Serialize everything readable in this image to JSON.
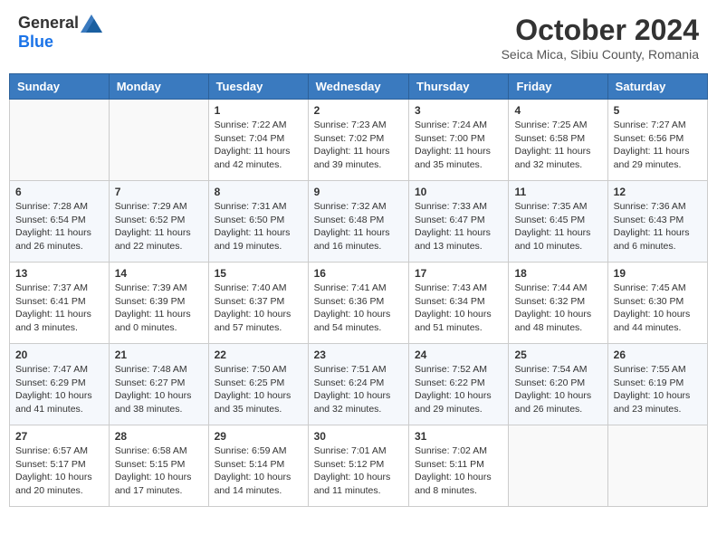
{
  "header": {
    "logo_general": "General",
    "logo_blue": "Blue",
    "month_title": "October 2024",
    "location": "Seica Mica, Sibiu County, Romania"
  },
  "days_of_week": [
    "Sunday",
    "Monday",
    "Tuesday",
    "Wednesday",
    "Thursday",
    "Friday",
    "Saturday"
  ],
  "weeks": [
    [
      {
        "day": "",
        "content": ""
      },
      {
        "day": "",
        "content": ""
      },
      {
        "day": "1",
        "content": "Sunrise: 7:22 AM\nSunset: 7:04 PM\nDaylight: 11 hours and 42 minutes."
      },
      {
        "day": "2",
        "content": "Sunrise: 7:23 AM\nSunset: 7:02 PM\nDaylight: 11 hours and 39 minutes."
      },
      {
        "day": "3",
        "content": "Sunrise: 7:24 AM\nSunset: 7:00 PM\nDaylight: 11 hours and 35 minutes."
      },
      {
        "day": "4",
        "content": "Sunrise: 7:25 AM\nSunset: 6:58 PM\nDaylight: 11 hours and 32 minutes."
      },
      {
        "day": "5",
        "content": "Sunrise: 7:27 AM\nSunset: 6:56 PM\nDaylight: 11 hours and 29 minutes."
      }
    ],
    [
      {
        "day": "6",
        "content": "Sunrise: 7:28 AM\nSunset: 6:54 PM\nDaylight: 11 hours and 26 minutes."
      },
      {
        "day": "7",
        "content": "Sunrise: 7:29 AM\nSunset: 6:52 PM\nDaylight: 11 hours and 22 minutes."
      },
      {
        "day": "8",
        "content": "Sunrise: 7:31 AM\nSunset: 6:50 PM\nDaylight: 11 hours and 19 minutes."
      },
      {
        "day": "9",
        "content": "Sunrise: 7:32 AM\nSunset: 6:48 PM\nDaylight: 11 hours and 16 minutes."
      },
      {
        "day": "10",
        "content": "Sunrise: 7:33 AM\nSunset: 6:47 PM\nDaylight: 11 hours and 13 minutes."
      },
      {
        "day": "11",
        "content": "Sunrise: 7:35 AM\nSunset: 6:45 PM\nDaylight: 11 hours and 10 minutes."
      },
      {
        "day": "12",
        "content": "Sunrise: 7:36 AM\nSunset: 6:43 PM\nDaylight: 11 hours and 6 minutes."
      }
    ],
    [
      {
        "day": "13",
        "content": "Sunrise: 7:37 AM\nSunset: 6:41 PM\nDaylight: 11 hours and 3 minutes."
      },
      {
        "day": "14",
        "content": "Sunrise: 7:39 AM\nSunset: 6:39 PM\nDaylight: 11 hours and 0 minutes."
      },
      {
        "day": "15",
        "content": "Sunrise: 7:40 AM\nSunset: 6:37 PM\nDaylight: 10 hours and 57 minutes."
      },
      {
        "day": "16",
        "content": "Sunrise: 7:41 AM\nSunset: 6:36 PM\nDaylight: 10 hours and 54 minutes."
      },
      {
        "day": "17",
        "content": "Sunrise: 7:43 AM\nSunset: 6:34 PM\nDaylight: 10 hours and 51 minutes."
      },
      {
        "day": "18",
        "content": "Sunrise: 7:44 AM\nSunset: 6:32 PM\nDaylight: 10 hours and 48 minutes."
      },
      {
        "day": "19",
        "content": "Sunrise: 7:45 AM\nSunset: 6:30 PM\nDaylight: 10 hours and 44 minutes."
      }
    ],
    [
      {
        "day": "20",
        "content": "Sunrise: 7:47 AM\nSunset: 6:29 PM\nDaylight: 10 hours and 41 minutes."
      },
      {
        "day": "21",
        "content": "Sunrise: 7:48 AM\nSunset: 6:27 PM\nDaylight: 10 hours and 38 minutes."
      },
      {
        "day": "22",
        "content": "Sunrise: 7:50 AM\nSunset: 6:25 PM\nDaylight: 10 hours and 35 minutes."
      },
      {
        "day": "23",
        "content": "Sunrise: 7:51 AM\nSunset: 6:24 PM\nDaylight: 10 hours and 32 minutes."
      },
      {
        "day": "24",
        "content": "Sunrise: 7:52 AM\nSunset: 6:22 PM\nDaylight: 10 hours and 29 minutes."
      },
      {
        "day": "25",
        "content": "Sunrise: 7:54 AM\nSunset: 6:20 PM\nDaylight: 10 hours and 26 minutes."
      },
      {
        "day": "26",
        "content": "Sunrise: 7:55 AM\nSunset: 6:19 PM\nDaylight: 10 hours and 23 minutes."
      }
    ],
    [
      {
        "day": "27",
        "content": "Sunrise: 6:57 AM\nSunset: 5:17 PM\nDaylight: 10 hours and 20 minutes."
      },
      {
        "day": "28",
        "content": "Sunrise: 6:58 AM\nSunset: 5:15 PM\nDaylight: 10 hours and 17 minutes."
      },
      {
        "day": "29",
        "content": "Sunrise: 6:59 AM\nSunset: 5:14 PM\nDaylight: 10 hours and 14 minutes."
      },
      {
        "day": "30",
        "content": "Sunrise: 7:01 AM\nSunset: 5:12 PM\nDaylight: 10 hours and 11 minutes."
      },
      {
        "day": "31",
        "content": "Sunrise: 7:02 AM\nSunset: 5:11 PM\nDaylight: 10 hours and 8 minutes."
      },
      {
        "day": "",
        "content": ""
      },
      {
        "day": "",
        "content": ""
      }
    ]
  ]
}
